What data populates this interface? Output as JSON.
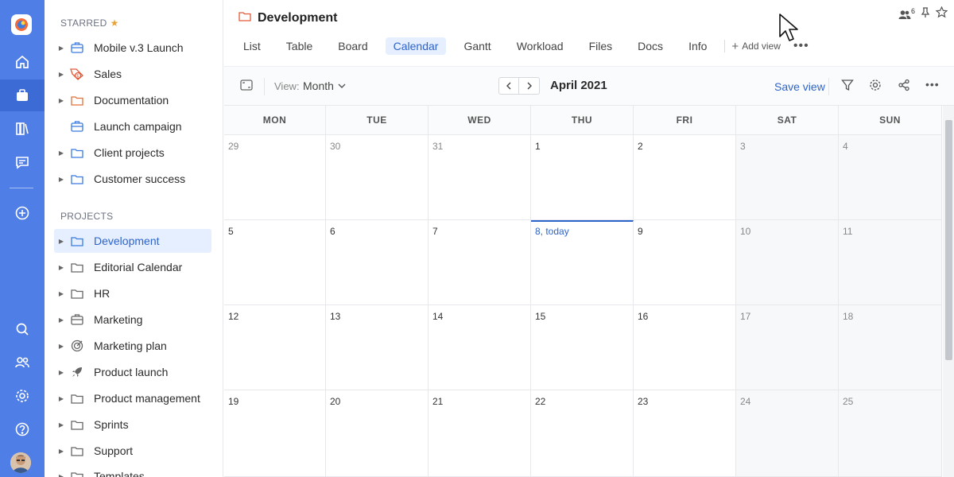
{
  "colors": {
    "rail": "#4f7ee6",
    "accent": "#2d64c9",
    "active_bg": "#e6efff",
    "star": "#e8a43a"
  },
  "rail": {
    "icons": [
      "home-icon",
      "portfolio-icon",
      "reports-icon",
      "inbox-icon",
      "add-icon",
      "search-icon",
      "users-icon",
      "settings-icon",
      "help-icon"
    ]
  },
  "sidebar": {
    "starred_title": "STARRED",
    "starred": [
      {
        "label": "Mobile v.3 Launch",
        "icon": "briefcase-icon"
      },
      {
        "label": "Sales",
        "icon": "dollar-tag-icon"
      },
      {
        "label": "Documentation",
        "icon": "folder-icon"
      },
      {
        "label": "Launch campaign",
        "icon": "briefcase-icon"
      },
      {
        "label": "Client projects",
        "icon": "folder-icon"
      },
      {
        "label": "Customer success",
        "icon": "folder-icon"
      }
    ],
    "projects_title": "PROJECTS",
    "projects": [
      {
        "label": "Development",
        "icon": "folder-icon"
      },
      {
        "label": "Editorial Calendar",
        "icon": "folder-icon"
      },
      {
        "label": "HR",
        "icon": "folder-icon"
      },
      {
        "label": "Marketing",
        "icon": "briefcase-icon"
      },
      {
        "label": "Marketing plan",
        "icon": "target-icon"
      },
      {
        "label": "Product launch",
        "icon": "rocket-icon"
      },
      {
        "label": "Product management",
        "icon": "folder-icon"
      },
      {
        "label": "Sprints",
        "icon": "folder-icon"
      },
      {
        "label": "Support",
        "icon": "folder-icon"
      },
      {
        "label": "Templates",
        "icon": "folder-icon"
      }
    ]
  },
  "header": {
    "title": "Development",
    "members_count": "6",
    "tabs": [
      "List",
      "Table",
      "Board",
      "Calendar",
      "Gantt",
      "Workload",
      "Files",
      "Docs",
      "Info"
    ],
    "active_tab": "Calendar",
    "add_view": "Add view"
  },
  "toolbar": {
    "view_label": "View:",
    "view_value": "Month",
    "month": "April 2021",
    "save_view": "Save view"
  },
  "calendar": {
    "days": [
      "MON",
      "TUE",
      "WED",
      "THU",
      "FRI",
      "SAT",
      "SUN"
    ],
    "weeks": [
      [
        "29",
        "30",
        "31",
        "1",
        "2",
        "3",
        "4"
      ],
      [
        "5",
        "6",
        "7",
        "8, today",
        "9",
        "10",
        "11"
      ],
      [
        "12",
        "13",
        "14",
        "15",
        "16",
        "17",
        "18"
      ],
      [
        "19",
        "20",
        "21",
        "22",
        "23",
        "24",
        "25"
      ]
    ],
    "outside_month": [
      [
        0,
        0
      ],
      [
        0,
        1
      ],
      [
        0,
        2
      ]
    ],
    "today": [
      1,
      3
    ]
  }
}
